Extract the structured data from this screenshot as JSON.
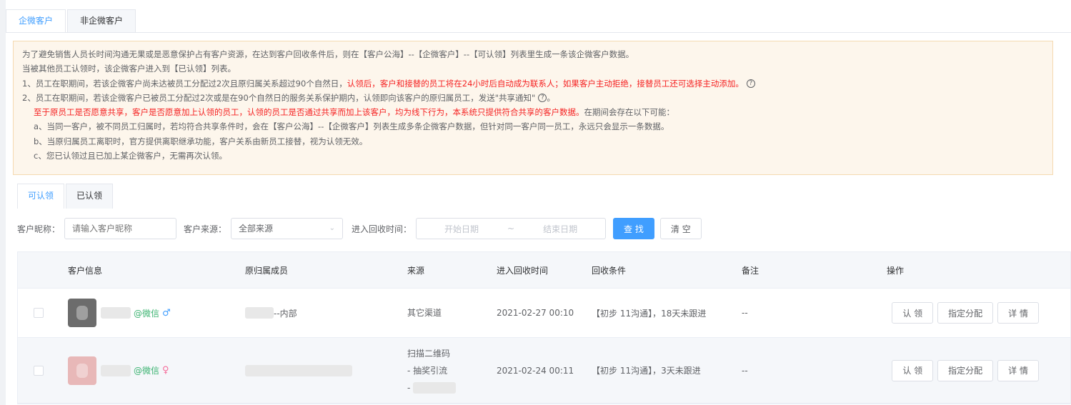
{
  "top_tabs": [
    "企微客户",
    "非企微客户"
  ],
  "notice": {
    "line1": "为了避免销售人员长时间沟通无果或是恶意保护占有客户资源，在达到客户回收条件后，则在【客户公海】--【企微客户】--【可认领】列表里生成一条该企微客户数据。",
    "line2": "当被其他员工认领时，该企微客户进入到【已认领】列表。",
    "line3_a": "1、员工在职期间，若该企微客户尚未达被员工分配过2次且原归属关系超过90个自然日，",
    "line3_b": "认领后，客户和接替的员工将在24小时后自动成为联系人；如果客户主动拒绝，接替员工还可选择主动添加。",
    "line4": "2、员工在职期间，若该企微客户已被员工分配过2次或是在90个自然日的服务关系保护期内，认领即向该客户的原归属员工，发送\"共享通知\"",
    "line5_a": "至于原员工是否愿意共享，客户是否愿意加上认领的员工，认领的员工是否通过共享而加上该客户，均为线下行为，本系统只提供符合共享的客户数据。",
    "line5_b": "在期间会存在以下可能：",
    "line6": "a、当同一客户，被不同员工归属时，若均符合共享条件时，会在【客户公海】--【企微客户】列表生成多条企微客户数据，但针对同一客户同一员工，永远只会显示一条数据。",
    "line7": "b、当原归属员工离职时，官方提供离职继承功能，客户关系由新员工接替，视为认领无效。",
    "line8": "c、您已认领过且已加上某企微客户，无需再次认领。",
    "line4_suffix": "。",
    "help_glyph": "?"
  },
  "sub_tabs": [
    "可认领",
    "已认领"
  ],
  "filter": {
    "nick_label": "客户昵称：",
    "nick_placeholder": "请输入客户昵称",
    "source_label": "客户来源：",
    "source_value": "全部来源",
    "time_label": "进入回收时间：",
    "start_placeholder": "开始日期",
    "range_sep": "~",
    "end_placeholder": "结束日期",
    "search_btn": "查 找",
    "clear_btn": "清 空"
  },
  "table": {
    "headers": [
      "客户信息",
      "原归属成员",
      "来源",
      "进入回收时间",
      "回收条件",
      "备注",
      "操作"
    ],
    "rows": [
      {
        "channel": "@微信",
        "gender": "♂",
        "member_suffix": "--内部",
        "source_lines": [
          "其它渠道"
        ],
        "time": "2021-02-27 00:10",
        "condition": "【初步 11沟通】，18天未跟进",
        "note": "--",
        "actions": [
          "认 领",
          "指定分配",
          "详 情"
        ]
      },
      {
        "channel": "@微信",
        "gender": "♀",
        "member_suffix": "",
        "source_lines": [
          "扫描二维码",
          "- 抽奖引流",
          "-"
        ],
        "time": "2021-02-24 00:11",
        "condition": "【初步 11沟通】，3天未跟进",
        "note": "--",
        "actions": [
          "认 领",
          "指定分配",
          "详 情"
        ]
      }
    ]
  }
}
